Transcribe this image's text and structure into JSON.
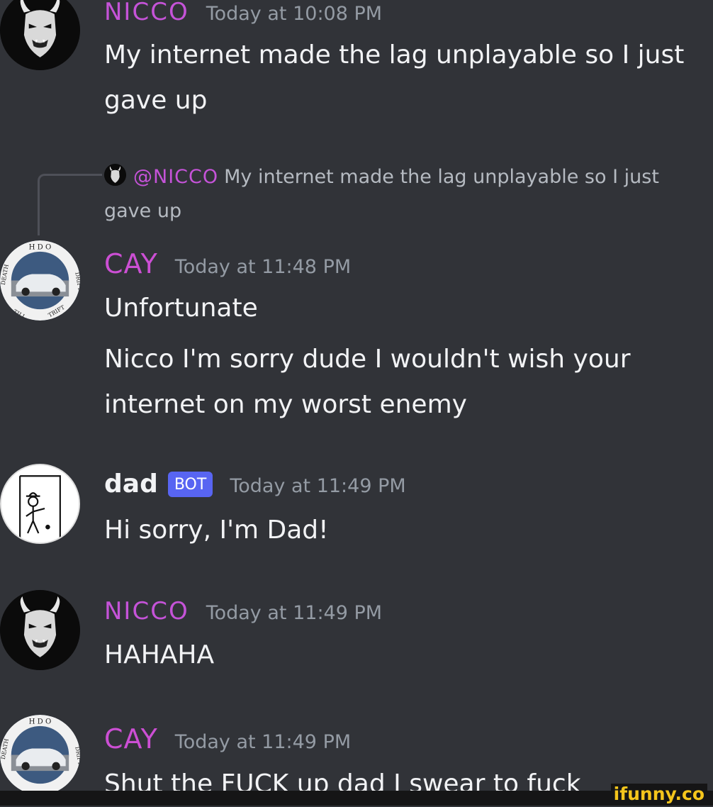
{
  "messages": [
    {
      "user": "NICCO",
      "time": "Today at 10:08 PM",
      "lines": [
        "My internet made the lag unplayable so I just",
        "gave up"
      ]
    },
    {
      "reply": {
        "mention": "@NICCO",
        "text_line1": "My internet made the lag unplayable so I just",
        "text_line2": "gave up"
      },
      "user": "CAY",
      "time": "Today at 11:48 PM",
      "lines": [
        "Unfortunate",
        "Nicco I'm sorry dude I wouldn't wish your",
        "internet on my worst enemy"
      ]
    },
    {
      "user": "dad",
      "bot_tag": "BOT",
      "time": "Today at 11:49 PM",
      "lines": [
        "Hi sorry, I'm Dad!"
      ]
    },
    {
      "user": "NICCO",
      "time": "Today at 11:49 PM",
      "lines": [
        "HAHAHA"
      ]
    },
    {
      "user": "CAY",
      "time": "Today at 11:49 PM",
      "lines": [
        "Shut the FUCK up dad I swear to fuck"
      ]
    }
  ],
  "avatars": {
    "cay_ring_top": "H D O",
    "cay_ring_left": "DEATH",
    "cay_ring_right": "DRIFT",
    "cay_ring_bottom_left": "TILL",
    "cay_ring_bottom_right": "TRIFT"
  },
  "watermark": "ifunny.co",
  "colors": {
    "background": "#313338",
    "nicco_name": "#c553d8",
    "cay_name": "#cc4fd4",
    "timestamp": "#949ba4",
    "bot_tag": "#5865f2"
  }
}
